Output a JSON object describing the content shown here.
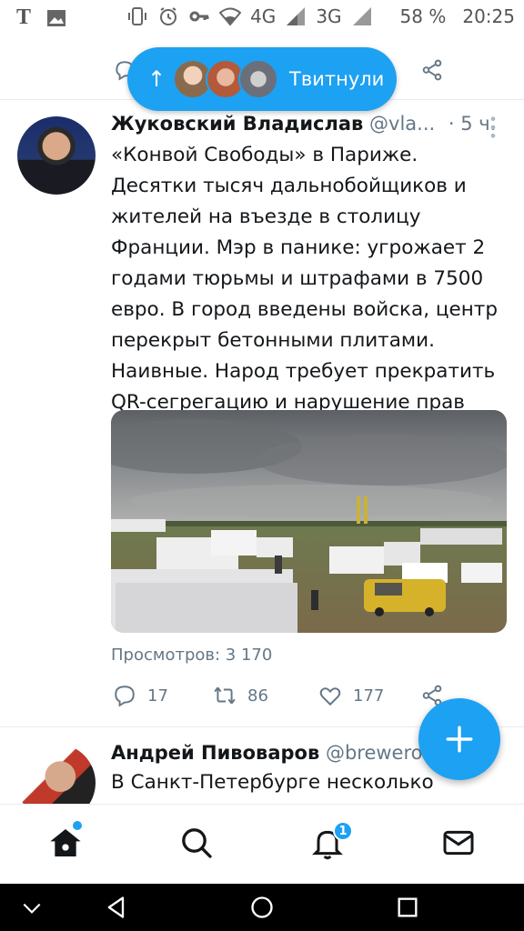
{
  "status_bar": {
    "battery": "58 %",
    "time": "20:25",
    "network_1": "4G",
    "network_2": "3G"
  },
  "new_tweets_pill": {
    "label": "Твитнули"
  },
  "tweet_main": {
    "author_name": "Жуковский Владислав",
    "handle": "@vla...",
    "time": "· 5 ч.",
    "text_lines": [
      "«Конвой Свободы» в Париже.",
      "Десятки тысяч дальнобойщиков и",
      "жителей на въезде в столицу",
      "Франции. Мэр в панике: угрожает 2",
      "годами тюрьмы и штрафами в 7500",
      "евро. В город введены войска, центр",
      "перекрыт бетонными плитами.",
      "Наивные. Народ требует прекратить",
      "QR-сегрегацию и нарушение прав"
    ],
    "views": "Просмотров: 3 170",
    "replies": "17",
    "retweets": "86",
    "likes": "177"
  },
  "tweet_second": {
    "author_name": "Андрей Пивоваров",
    "handle": "@brewerov",
    "text": "В Санкт-Петербурге несколько"
  },
  "bottom_nav": {
    "notifications_badge": "1"
  },
  "colors": {
    "accent": "#1da1f2",
    "text": "#14171a",
    "secondary": "#657786"
  }
}
